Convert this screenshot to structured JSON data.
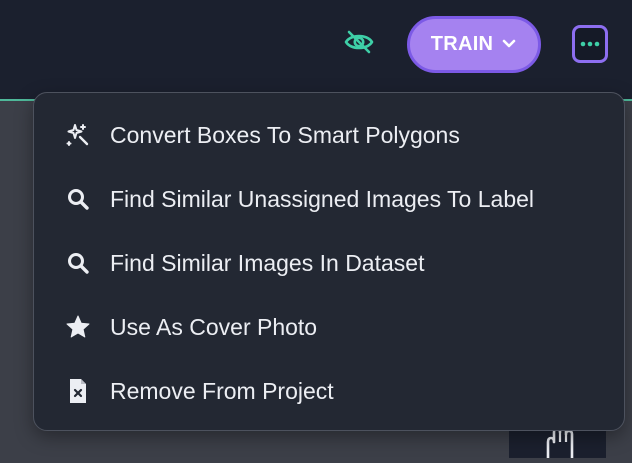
{
  "header": {
    "train_label": "TRAIN",
    "visibility_icon": "eye-off-icon",
    "more_icon": "dots-horizontal-icon",
    "accent_color": "#a582f0",
    "visibility_color": "#3ecfa7"
  },
  "menu": {
    "items": [
      {
        "label": "Convert Boxes To Smart Polygons",
        "icon": "magic-sparkle-icon"
      },
      {
        "label": "Find Similar Unassigned Images To Label",
        "icon": "search-icon"
      },
      {
        "label": "Find Similar Images In Dataset",
        "icon": "search-icon"
      },
      {
        "label": "Use As Cover Photo",
        "icon": "star-icon"
      },
      {
        "label": "Remove From Project",
        "icon": "file-remove-icon"
      }
    ]
  },
  "toolbar": {
    "pan_icon": "hand-icon"
  }
}
